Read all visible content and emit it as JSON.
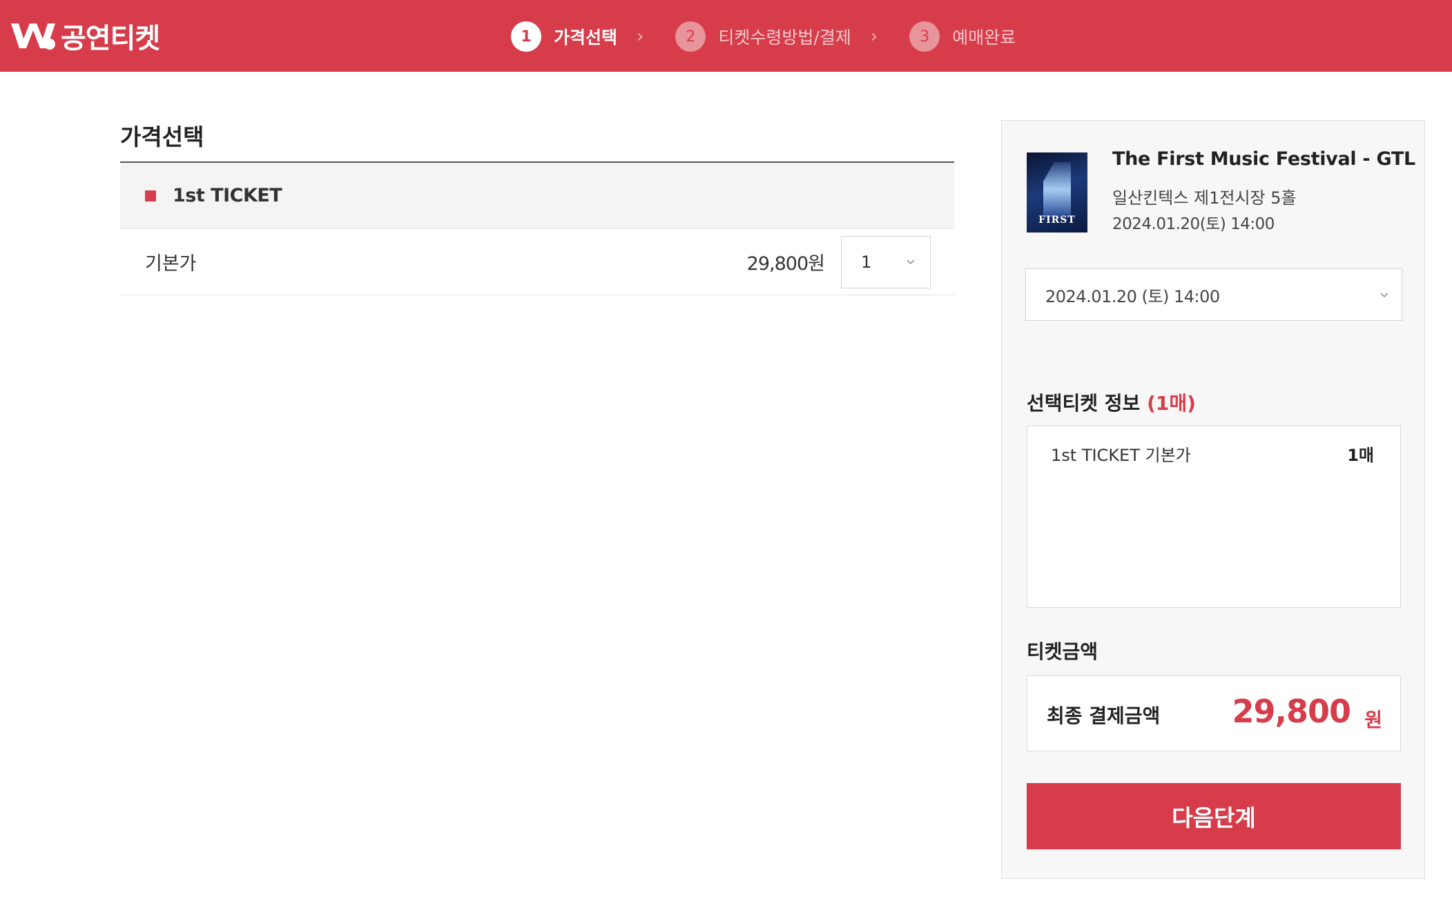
{
  "header": {
    "logo_text": "공연티켓",
    "bg_color": "#d63c4a",
    "steps": [
      {
        "num": "1",
        "label": "가격선택",
        "active": true
      },
      {
        "num": "2",
        "label": "티켓수령방법/결제",
        "active": false
      },
      {
        "num": "3",
        "label": "예매완료",
        "active": false
      }
    ]
  },
  "price_section": {
    "title": "가격선택",
    "grade": "1st TICKET",
    "price_type": "기본가",
    "price": "29,800원",
    "quantity": "1"
  },
  "side_panel": {
    "poster_text": "FIRST",
    "event_title": "The First Music Festival - GTL",
    "venue": "일산킨텍스 제1전시장 5홀",
    "date": "2024.01.20(토) 14:00",
    "date_select_value": "2024.01.20 (토) 14:00",
    "selected_title": "선택티켓 정보",
    "selected_count": "(1매)",
    "selected_item": "1st TICKET 기본가",
    "selected_item_qty": "1매",
    "amount_title": "티켓금액",
    "total_label": "최종 결제금액",
    "total_amount": "29,800",
    "total_unit": "원",
    "next_button": "다음단계"
  },
  "accent_color": "#d63c4a"
}
